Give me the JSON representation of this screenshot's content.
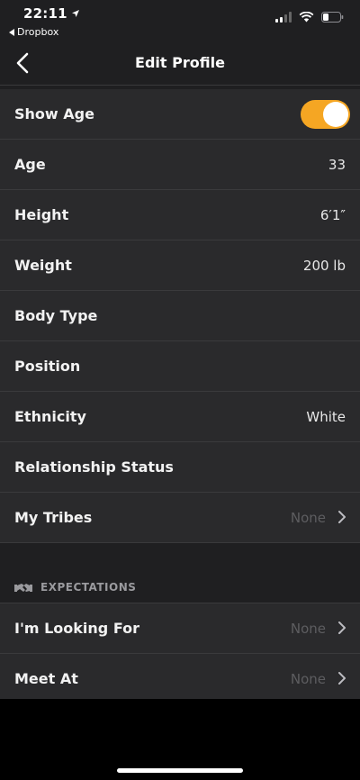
{
  "status_bar": {
    "time": "22:11",
    "back_app": "Dropbox",
    "icons": [
      "location-arrow-icon",
      "cellular-signal-icon",
      "wifi-icon",
      "battery-icon"
    ]
  },
  "nav": {
    "title": "Edit Profile",
    "back_icon": "chevron-left-icon"
  },
  "rows": [
    {
      "label": "Show Age",
      "value": "",
      "toggle": true
    },
    {
      "label": "Age",
      "value": "33"
    },
    {
      "label": "Height",
      "value": "6′1″"
    },
    {
      "label": "Weight",
      "value": "200 lb"
    },
    {
      "label": "Body Type",
      "value": ""
    },
    {
      "label": "Position",
      "value": ""
    },
    {
      "label": "Ethnicity",
      "value": "White"
    },
    {
      "label": "Relationship Status",
      "value": ""
    },
    {
      "label": "My Tribes",
      "value": "None"
    }
  ],
  "expectations": {
    "header": "EXPECTATIONS",
    "header_icon": "handshake-icon",
    "rows": [
      {
        "label": "I'm Looking For",
        "value": "None"
      },
      {
        "label": "Meet At",
        "value": "None"
      }
    ]
  },
  "colors": {
    "accent": "#f5a623",
    "background": "#1f1f21",
    "row": "#2a2a2c",
    "divider": "#3a3a3c"
  }
}
